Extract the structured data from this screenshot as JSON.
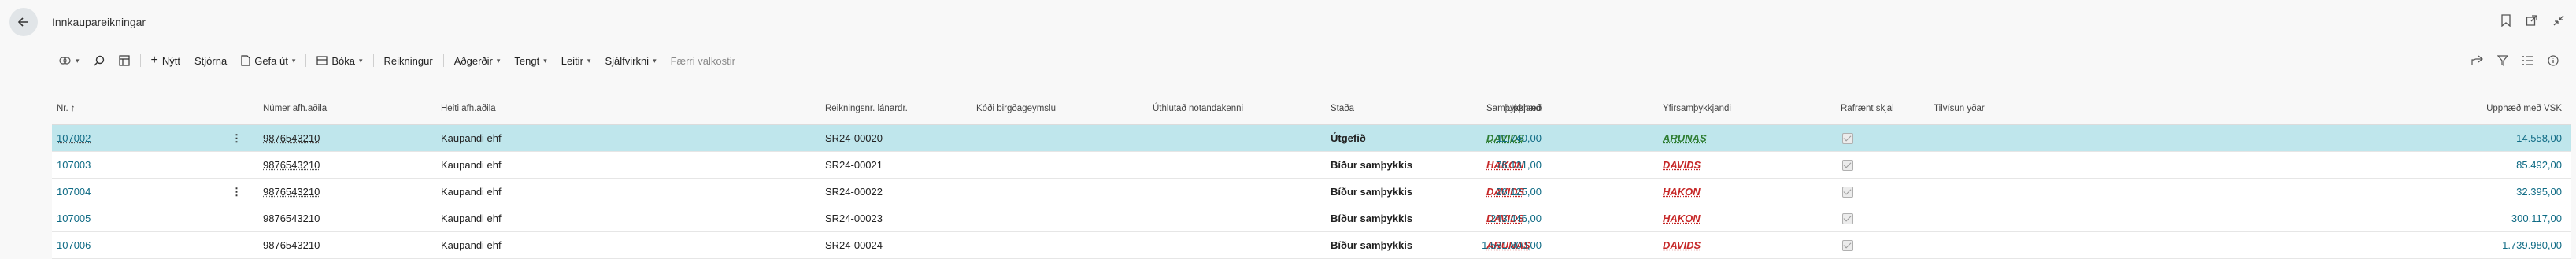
{
  "page": {
    "title": "Innkaupareikningar"
  },
  "actions": {
    "new": "Nýtt",
    "manage": "Stjórna",
    "issue": "Gefa út",
    "post": "Bóka",
    "invoice": "Reikningur",
    "actions": "Aðgerðir",
    "related": "Tengt",
    "reports": "Leitir",
    "automate": "Sjálfvirkni",
    "fewer_options": "Færri valkostir"
  },
  "columns": {
    "no": "Nr. ↑",
    "vendor_no": "Númer afh.aðila",
    "vendor_name": "Heiti afh.aðila",
    "invoice_no": "Reikningsnr. lánardr.",
    "location": "Kóði birgðageymslu",
    "assigned_user": "Úthlutað notandakenni",
    "status": "Staða",
    "approver": "Samþykkjandi",
    "super_approver": "Yfirsamþykkjandi",
    "e_document": "Rafrænt skjal",
    "reference": "Tilvísun yðar",
    "amount": "Upphæð",
    "amount_vat": "Upphæð með VSK"
  },
  "rows": [
    {
      "no": "107002",
      "vendor_no": "9876543210",
      "vendor_name": "Kaupandi ehf",
      "invoice_no": "SR24-00020",
      "status": "Útgefið",
      "approver": "DAVIDS",
      "super_approver": "ARUNAS",
      "amount": "11.740,00",
      "amount_vat": "14.558,00"
    },
    {
      "no": "107003",
      "vendor_no": "9876543210",
      "vendor_name": "Kaupandi ehf",
      "invoice_no": "SR24-00021",
      "status": "Bíður samþykkis",
      "approver": "HAKON",
      "super_approver": "DAVIDS",
      "amount": "76.131,00",
      "amount_vat": "85.492,00"
    },
    {
      "no": "107004",
      "vendor_no": "9876543210",
      "vendor_name": "Kaupandi ehf",
      "invoice_no": "SR24-00022",
      "status": "Bíður samþykkis",
      "approver": "DAVIDS",
      "super_approver": "HAKON",
      "amount": "26.125,00",
      "amount_vat": "32.395,00"
    },
    {
      "no": "107005",
      "vendor_no": "9876543210",
      "vendor_name": "Kaupandi ehf",
      "invoice_no": "SR24-00023",
      "status": "Bíður samþykkis",
      "approver": "DAVIDS",
      "super_approver": "HAKON",
      "amount": "243.446,00",
      "amount_vat": "300.117,00"
    },
    {
      "no": "107006",
      "vendor_no": "9876543210",
      "vendor_name": "Kaupandi ehf",
      "invoice_no": "SR24-00024",
      "status": "Bíður samþykkis",
      "approver": "ARUNAS",
      "super_approver": "DAVIDS",
      "amount": "1.581.800,00",
      "amount_vat": "1.739.980,00"
    }
  ],
  "colors": {
    "accent": "#0f6b85",
    "selected_row": "#bfe6ec",
    "approver_red": "#c62828",
    "approver_green": "#2e7d32"
  }
}
